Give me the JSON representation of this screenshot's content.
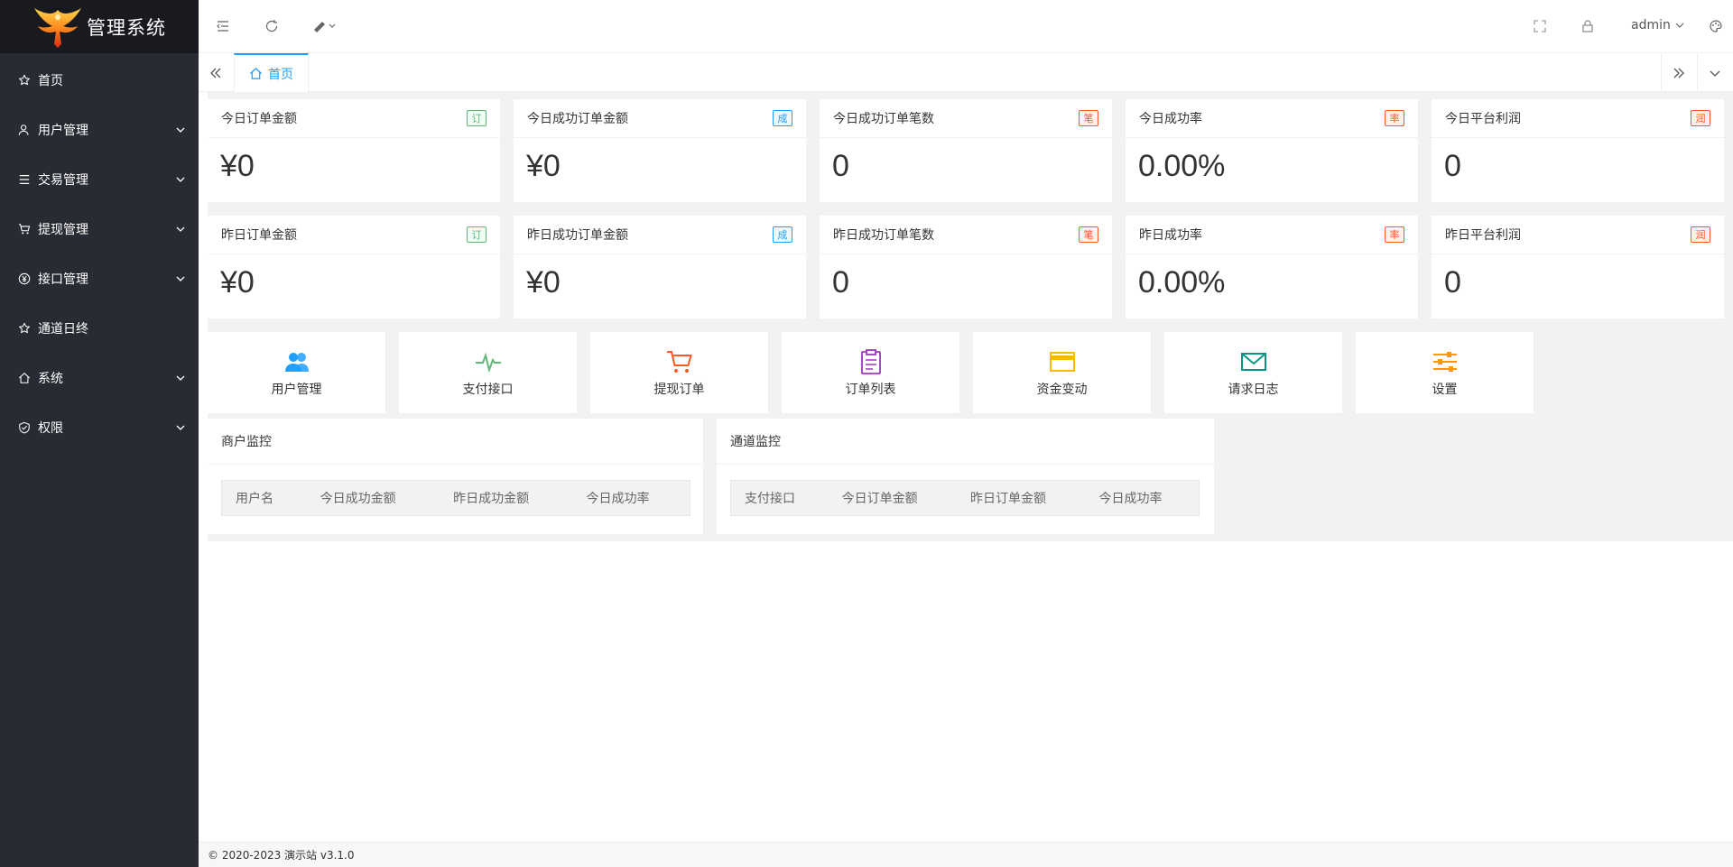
{
  "app": {
    "logo_text": "管理系统"
  },
  "sidebar": {
    "items": [
      {
        "label": "首页",
        "icon": "star-icon",
        "has_arrow": false
      },
      {
        "label": "用户管理",
        "icon": "user-icon",
        "has_arrow": true
      },
      {
        "label": "交易管理",
        "icon": "list-icon",
        "has_arrow": true
      },
      {
        "label": "提现管理",
        "icon": "cart-icon",
        "has_arrow": true
      },
      {
        "label": "接口管理",
        "icon": "yen-icon",
        "has_arrow": true
      },
      {
        "label": "通道日终",
        "icon": "star-icon",
        "has_arrow": false
      },
      {
        "label": "系统",
        "icon": "home-icon",
        "has_arrow": true
      },
      {
        "label": "权限",
        "icon": "shield-icon",
        "has_arrow": true
      }
    ]
  },
  "header": {
    "user": "admin"
  },
  "tabs": {
    "home": "首页"
  },
  "stats_today": [
    {
      "title": "今日订单金额",
      "badge": "订",
      "color": "green",
      "value": "¥0"
    },
    {
      "title": "今日成功订单金额",
      "badge": "成",
      "color": "blue",
      "value": "¥0"
    },
    {
      "title": "今日成功订单笔数",
      "badge": "笔",
      "color": "red",
      "value": "0"
    },
    {
      "title": "今日成功率",
      "badge": "率",
      "color": "red",
      "value": "0.00%"
    },
    {
      "title": "今日平台利润",
      "badge": "润",
      "color": "red",
      "value": "0"
    }
  ],
  "stats_yesterday": [
    {
      "title": "昨日订单金额",
      "badge": "订",
      "color": "green",
      "value": "¥0"
    },
    {
      "title": "昨日成功订单金额",
      "badge": "成",
      "color": "blue",
      "value": "¥0"
    },
    {
      "title": "昨日成功订单笔数",
      "badge": "笔",
      "color": "red",
      "value": "0"
    },
    {
      "title": "昨日成功率",
      "badge": "率",
      "color": "red",
      "value": "0.00%"
    },
    {
      "title": "昨日平台利润",
      "badge": "润",
      "color": "red",
      "value": "0"
    }
  ],
  "shortcuts": [
    {
      "label": "用户管理",
      "icon": "users-icon",
      "color": "#1e9fff"
    },
    {
      "label": "支付接口",
      "icon": "pulse-icon",
      "color": "#5fb878"
    },
    {
      "label": "提现订单",
      "icon": "cart-icon",
      "color": "#ff5722"
    },
    {
      "label": "订单列表",
      "icon": "clipboard-icon",
      "color": "#a233c6"
    },
    {
      "label": "资金变动",
      "icon": "card-icon",
      "color": "#ffb800"
    },
    {
      "label": "请求日志",
      "icon": "mail-icon",
      "color": "#009688"
    },
    {
      "label": "设置",
      "icon": "sliders-icon",
      "color": "#ff9800"
    }
  ],
  "merchant_monitor": {
    "title": "商户监控",
    "columns": [
      "用户名",
      "今日成功金额",
      "昨日成功金额",
      "今日成功率"
    ]
  },
  "channel_monitor": {
    "title": "通道监控",
    "columns": [
      "支付接口",
      "今日订单金额",
      "昨日订单金额",
      "今日成功率"
    ]
  },
  "footer": {
    "text": "© 2020-2023 演示站 v3.1.0"
  }
}
